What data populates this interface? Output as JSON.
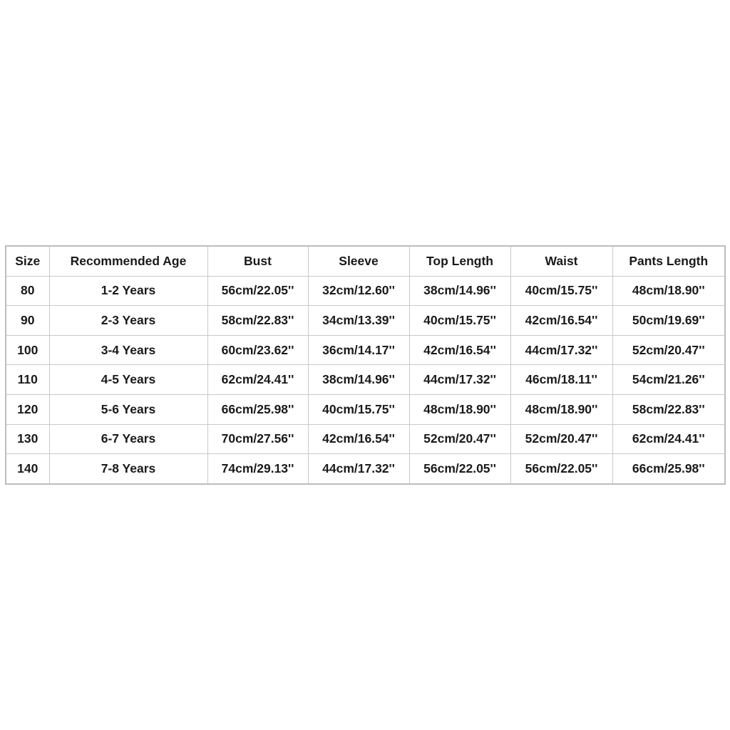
{
  "table": {
    "headers": [
      "Size",
      "Recommended Age",
      "Bust",
      "Sleeve",
      "Top Length",
      "Waist",
      "Pants Length"
    ],
    "rows": [
      [
        "80",
        "1-2 Years",
        "56cm/22.05''",
        "32cm/12.60''",
        "38cm/14.96''",
        "40cm/15.75''",
        "48cm/18.90''"
      ],
      [
        "90",
        "2-3 Years",
        "58cm/22.83''",
        "34cm/13.39''",
        "40cm/15.75''",
        "42cm/16.54''",
        "50cm/19.69''"
      ],
      [
        "100",
        "3-4 Years",
        "60cm/23.62''",
        "36cm/14.17''",
        "42cm/16.54''",
        "44cm/17.32''",
        "52cm/20.47''"
      ],
      [
        "110",
        "4-5 Years",
        "62cm/24.41''",
        "38cm/14.96''",
        "44cm/17.32''",
        "46cm/18.11''",
        "54cm/21.26''"
      ],
      [
        "120",
        "5-6 Years",
        "66cm/25.98''",
        "40cm/15.75''",
        "48cm/18.90''",
        "48cm/18.90''",
        "58cm/22.83''"
      ],
      [
        "130",
        "6-7 Years",
        "70cm/27.56''",
        "42cm/16.54''",
        "52cm/20.47''",
        "52cm/20.47''",
        "62cm/24.41''"
      ],
      [
        "140",
        "7-8 Years",
        "74cm/29.13''",
        "44cm/17.32''",
        "56cm/22.05''",
        "56cm/22.05''",
        "66cm/25.98''"
      ]
    ]
  }
}
